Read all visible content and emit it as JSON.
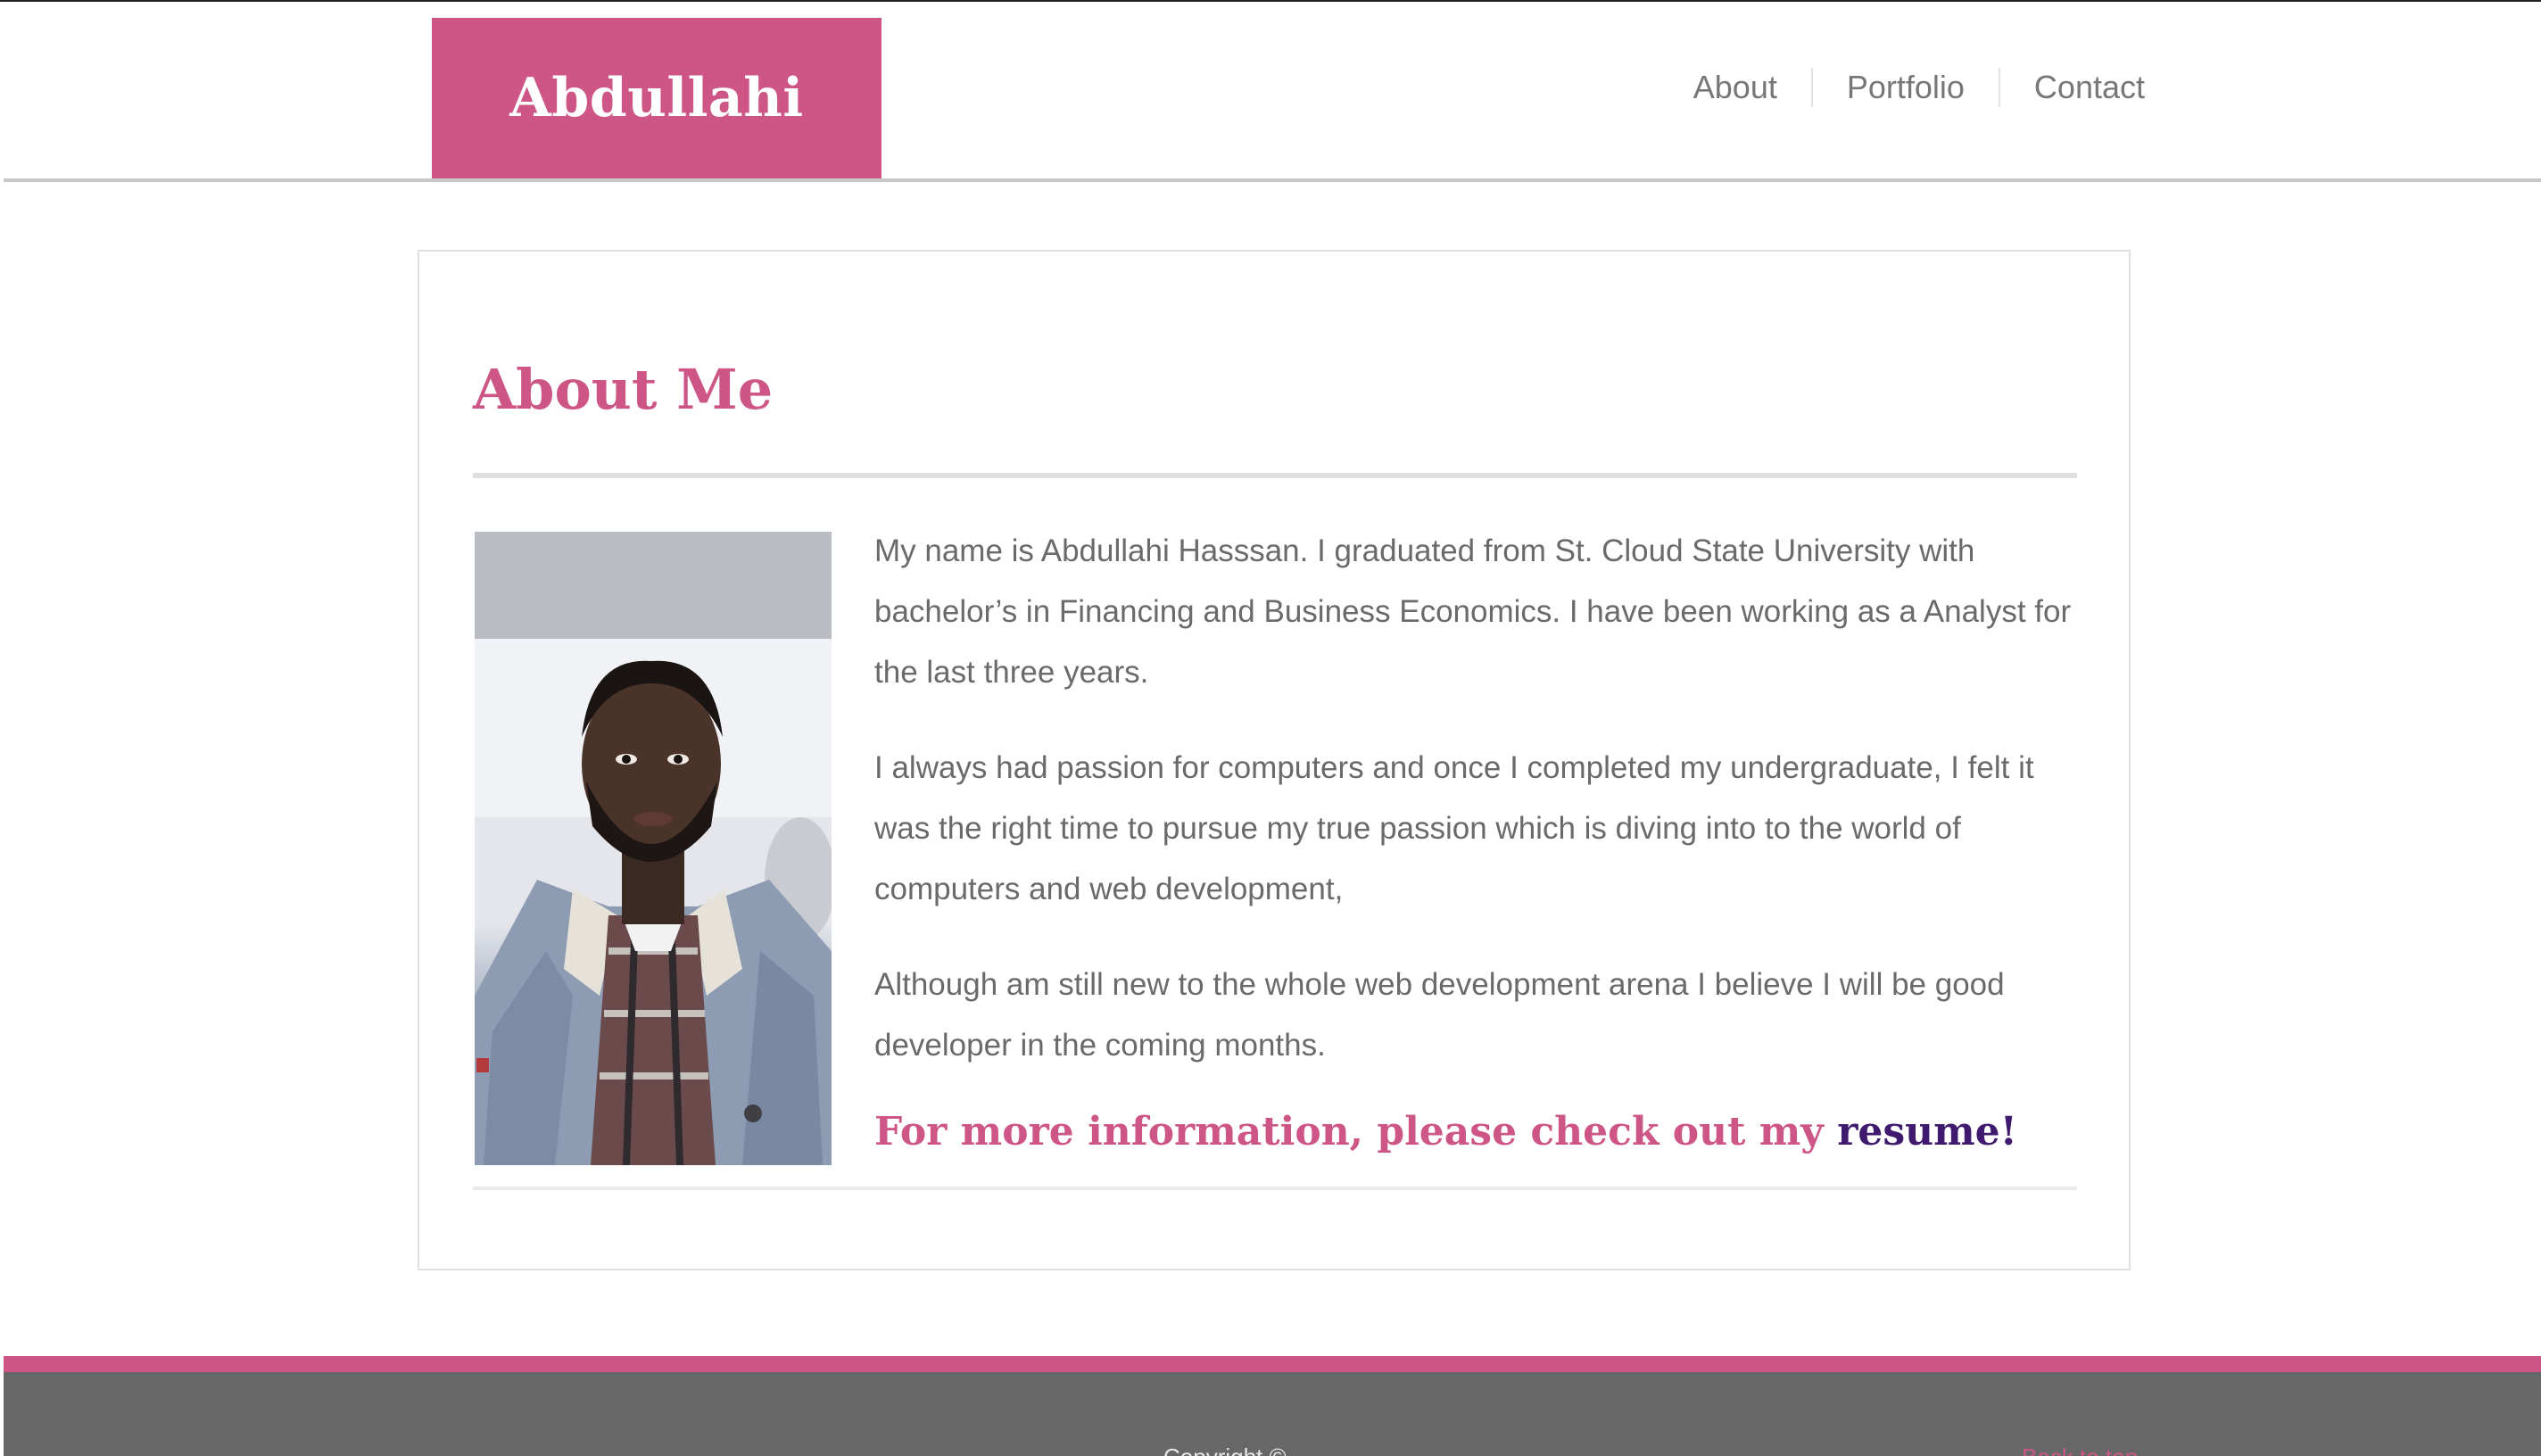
{
  "header": {
    "logo": "Abdullahi",
    "nav": [
      {
        "label": "About"
      },
      {
        "label": "Portfolio"
      },
      {
        "label": "Contact"
      }
    ]
  },
  "about": {
    "title": "About Me",
    "photo": "profile-photo",
    "paragraphs": [
      "My name is Abdullahi Hasssan. I graduated from St. Cloud State University with bachelor’s in Financing and Business Economics. I have been working as a Analyst for the last three years.",
      "I always had passion for computers and once I completed my undergraduate, I felt it was the right time to pursue my true passion which is diving into to the world of computers and web development,",
      "Although am still new to the whole web development arena I believe I will be good developer in the coming months."
    ],
    "cta_text": "For more information, please check out my ",
    "cta_link": "resume!"
  },
  "footer": {
    "copyright": "Copyright ©",
    "back_to_top": "Back to top"
  },
  "colors": {
    "accent": "#cd5686",
    "link_visited": "#3f1a6e",
    "footer_bg": "#676767"
  }
}
